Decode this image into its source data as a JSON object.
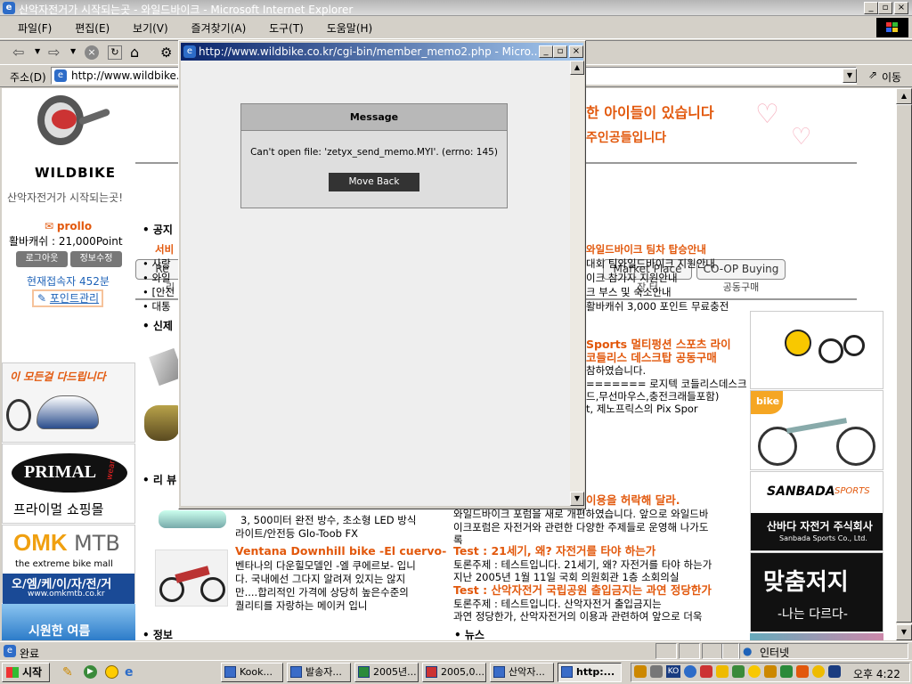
{
  "window": {
    "title": "산악자전거가 시작되는곳 - 와일드바이크 - Microsoft Internet Explorer"
  },
  "menu": [
    "파일(F)",
    "편집(E)",
    "보기(V)",
    "즐겨찾기(A)",
    "도구(T)",
    "도움말(H)"
  ],
  "address": {
    "label": "주소(D)",
    "url": "http://www.wildbike.",
    "go_label": "이동"
  },
  "popup": {
    "title": "http://www.wildbike.co.kr/cgi-bin/member_memo2.php - Micro...",
    "message_header": "Message",
    "message_text": "Can't open file: 'zetyx_send_memo.MYI'. (errno: 145)",
    "button_label": "Move Back"
  },
  "site": {
    "logo_text": "WILDBIKE",
    "tagline": "산악자전거가 시작되는곳!",
    "user": {
      "name": "prollo",
      "points": "활바캐쉬 : 21,000Point",
      "logout": "로그아웃",
      "edit": "정보수정",
      "online": "현재접속자 452분",
      "point_manage": "포인트관리"
    },
    "header_lines": [
      "한 아이들이 있습니다",
      "주인공들입니다"
    ],
    "tabs": [
      {
        "label": "Re",
        "sub": "리"
      },
      {
        "label": "Market Place",
        "sub": "장 터"
      },
      {
        "label": "CO-OP Buying",
        "sub": "공동구매"
      }
    ],
    "notice": {
      "title": "공지",
      "left_lines": [
        "서비",
        "사랑",
        "와일",
        "[안전",
        "대통"
      ],
      "right_title": "와일드바이크 팀차 탑승안내",
      "right_lines": [
        "대회 팀와일드바이크 지원안내",
        "이크 참가자 지원안내",
        "크 부스 및 숙소안내",
        "활바캐쉬 3,000 포인트 무료충전"
      ]
    },
    "new_section": "신제",
    "review_section": "리 뷰",
    "info_section": "정보",
    "news_section": "뉴스",
    "promo": {
      "lines_orange": [
        "Sports 멀티펑션 스포츠 라이",
        "코들리스 데스크탑 공동구매"
      ],
      "lines": [
        "참하였습니다.",
        "======= 로지텍 코들리스데스크",
        "드,무선마우스,충전크래들포함)",
        "t, 제노프릭스의 Pix Spor"
      ]
    },
    "left_banners": [
      "이 모든걸 다드립니다",
      "PRIMAL",
      "wear",
      "프라이멀 쇼핑몰",
      "OMK",
      "MTB",
      "the extreme bike mall",
      "오/엠/케/이/자/전/거",
      "www.omkmtb.co.kr",
      "시원한 여름"
    ],
    "reviews": [
      {
        "title": "",
        "body": [
          "3, 500미터 완전 방수, 초소형 LED 방식",
          "라이트/안전등 Glo-Toob FX"
        ]
      },
      {
        "title": "Ventana Downhill bike -El cuervo-",
        "body": [
          "벤타나의 다운힐모델인 -엘 쿠에르보- 입니",
          "다. 국내에선 그다지 알려져 있지는 않지",
          "만....합리적인 가격에 상당히 높은수준의",
          "퀄리티를 자랑하는 메이커 입니"
        ]
      }
    ],
    "forum": [
      {
        "title": "이용을 허락해 달라.",
        "body": [
          "와일드바이크 포럼을 새로 개편하였습니다. 앞으로 와일드바",
          "이크포럼은 자전거와 관련한 다양한 주제들로 운영해 나가도",
          "록"
        ]
      },
      {
        "title": "Test : 21세기, 왜? 자전거를 타야 하는가",
        "body": [
          "토론주제 : 테스트입니다. 21세기, 왜? 자전거를 타야 하는가",
          "지난 2005년 1월 11일 국회 의원회관 1층 소회의실"
        ]
      },
      {
        "title": "Test : 산악자전거 국립공원 출입금지는 과연 정당한가",
        "body": [
          "토론주제 : 테스트입니다. 산악자전거 출입금지는",
          "과연 정당한가, 산악자전거의 이용과 관련하여 앞으로 더욱"
        ]
      }
    ],
    "right_ads": [
      "bike",
      "SANBADA",
      "SPORTS",
      "산바다 자전거 주식회사",
      "Sanbada Sports Co., Ltd.",
      "맞춤저지",
      "-나는 다르다-"
    ]
  },
  "status": {
    "text": "완료",
    "zone": "인터넷"
  },
  "taskbar": {
    "start": "시작",
    "tasks": [
      "Kook...",
      "발송자...",
      "2005년...",
      "2005,0...",
      "산악자...",
      "http:..."
    ],
    "ime": "KO",
    "clock": "오후 4:22"
  }
}
